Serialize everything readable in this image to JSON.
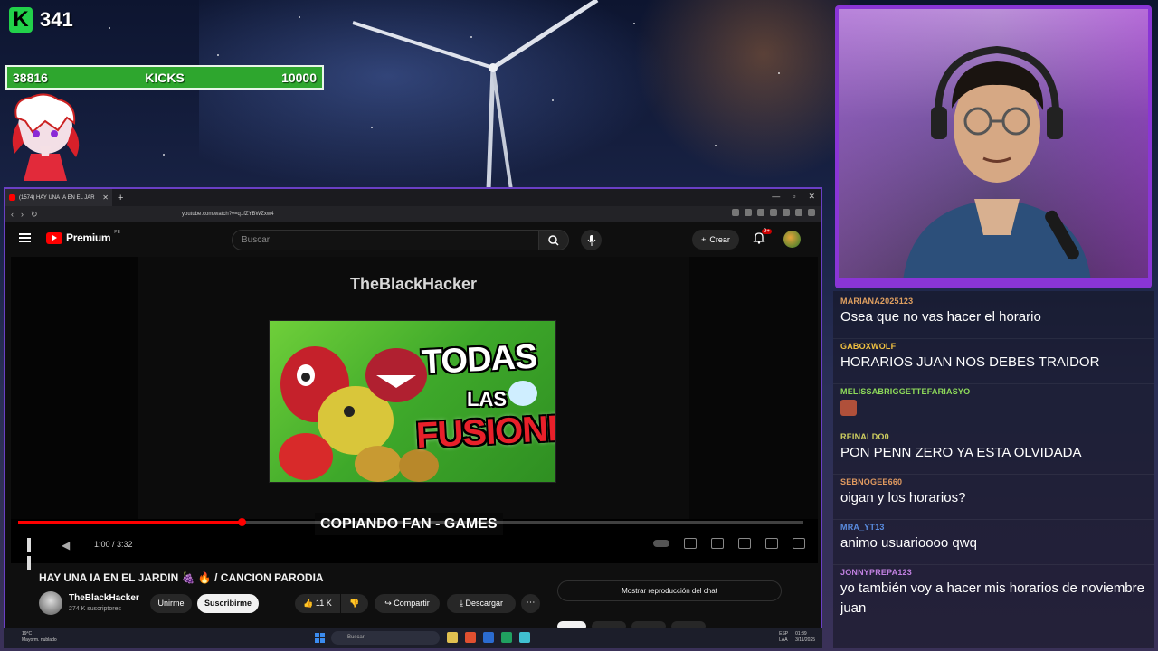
{
  "overlay": {
    "kick_count": "341",
    "kicks_bar": {
      "left_value": "38816",
      "label": "KICKS",
      "right_value": "10000"
    },
    "kick_logo": "K"
  },
  "browser": {
    "tab_title": "(1574) HAY UNA IA EN EL JAR",
    "url": "youtube.com/watch?v=q1fZYBWZxw4"
  },
  "youtube": {
    "brand": "Premium",
    "region": "PE",
    "search_placeholder": "Buscar",
    "create_label": "Crear",
    "notif_badge": "9+",
    "player": {
      "watermark": "TheBlackHacker",
      "thumbnail_lines": [
        "TODAS",
        "LAS",
        "FUSIONES"
      ],
      "subtitle": "COPIANDO FAN - GAMES",
      "time": "1:00 / 3:32",
      "progress": 0.285
    },
    "video_title": "HAY UNA IA EN EL JARDIN 🍇 🔥 / CANCION PARODIA",
    "channel": {
      "name": "TheBlackHacker",
      "subs": "274 K suscriptores"
    },
    "buttons": {
      "join": "Unirme",
      "subscribe": "Suscribirme",
      "likes": "11 K",
      "share": "Compartir",
      "download": "Descargar",
      "chat_replay": "Mostrar reproducción del chat"
    }
  },
  "taskbar": {
    "weather_temp": "19°C",
    "weather_desc": "Mayorm. nublado",
    "search": "Buscar",
    "lang": "ESP",
    "lang_sub": "LAA",
    "time": "01:39",
    "date": "3/11/2025"
  },
  "chat": {
    "messages": [
      {
        "user": "MARIANA2025123",
        "color": "#e0a060",
        "text": "Osea que no vas hacer el horario"
      },
      {
        "user": "GABOXWOLF",
        "color": "#f0c040",
        "text": "HORARIOS JUAN NOS DEBES TRAIDOR"
      },
      {
        "user": "MELISSABRIGGETTEFARIASYO",
        "color": "#8fdc5a",
        "text": ""
      },
      {
        "user": "REINALDO0",
        "color": "#d0d060",
        "text": "PON PENN ZERO YA ESTA OLVIDADA"
      },
      {
        "user": "SEBNOGEE660",
        "color": "#e09a60",
        "text": "oigan y los horarios?"
      },
      {
        "user": "MRA_YT13",
        "color": "#5a8ce0",
        "text": "animo usuarioooo qwq"
      },
      {
        "user": "JONNYPREPA123",
        "color": "#c080e0",
        "text": "yo también voy a hacer mis horarios de noviembre juan"
      }
    ]
  }
}
